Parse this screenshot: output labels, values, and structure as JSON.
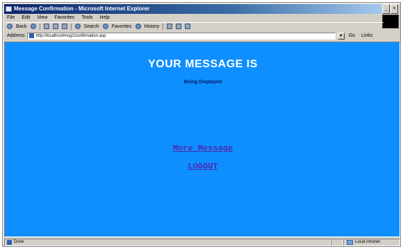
{
  "window": {
    "title": "Message Confirmation - Microsoft Internet Explorer",
    "controls": {
      "minimize": "_",
      "close": "×"
    }
  },
  "menubar": {
    "items": [
      "File",
      "Edit",
      "View",
      "Favorites",
      "Tools",
      "Help"
    ]
  },
  "toolbar": {
    "back_label": "Back",
    "search_label": "Search",
    "favorites_label": "Favorites",
    "history_label": "History"
  },
  "addressbar": {
    "label": "Address",
    "url": "http://localhost/msg1/confirmation.asp",
    "go_label": "Go",
    "links_label": "Links"
  },
  "page": {
    "heading": "YOUR MESSAGE IS",
    "subheading": "Being Displayed",
    "more_message_link": "More Message",
    "logout_link": "LOGOUT",
    "background_color": "#0f8fff"
  },
  "statusbar": {
    "status_text": "Done",
    "zone_text": "Local intranet"
  }
}
